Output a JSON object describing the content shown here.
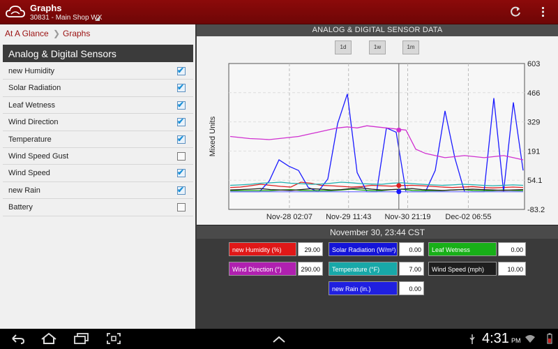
{
  "app": {
    "title": "Graphs",
    "subtitle": "30831 - Main Shop WX"
  },
  "breadcrumb": {
    "home": "At A Glance",
    "separator": "❯",
    "current": "Graphs"
  },
  "sensors": {
    "header": "Analog & Digital Sensors",
    "items": [
      {
        "label": "new Humidity",
        "checked": true
      },
      {
        "label": "Solar Radiation",
        "checked": true
      },
      {
        "label": "Leaf Wetness",
        "checked": true
      },
      {
        "label": "Wind Direction",
        "checked": true
      },
      {
        "label": "Temperature",
        "checked": true
      },
      {
        "label": "Wind Speed Gust",
        "checked": false
      },
      {
        "label": "Wind Speed",
        "checked": true
      },
      {
        "label": "new Rain",
        "checked": true
      },
      {
        "label": "Battery",
        "checked": false
      }
    ]
  },
  "chart": {
    "header": "ANALOG & DIGITAL SENSOR DATA",
    "range_buttons": [
      "1d",
      "1w",
      "1m"
    ],
    "selected_time": "November 30, 23:44 CST"
  },
  "chart_data": {
    "type": "line",
    "ylabel": "Mixed Units",
    "y_ticks": [
      "603",
      "466",
      "329",
      "191",
      "54.1",
      "-83.2"
    ],
    "ylim": [
      -83.2,
      603
    ],
    "x_ticks": [
      "Nov-28 02:07",
      "Nov-29 11:43",
      "Nov-30 21:19",
      "Dec-02 06:55"
    ],
    "cursor_x": 0.575,
    "series": [
      {
        "name": "new Humidity",
        "color": "#e02020",
        "values": [
          20,
          22,
          28,
          35,
          30,
          25,
          22,
          45,
          40,
          30,
          28,
          25,
          22,
          24,
          30,
          28,
          26,
          29,
          30,
          28,
          25,
          22,
          20,
          22,
          24,
          20,
          18,
          20,
          22,
          20
        ]
      },
      {
        "name": "Solar Radiation",
        "color": "#1a1aff",
        "values": [
          0,
          0,
          0,
          0,
          50,
          150,
          120,
          100,
          20,
          0,
          60,
          320,
          460,
          90,
          0,
          0,
          300,
          280,
          0,
          0,
          0,
          100,
          380,
          160,
          0,
          0,
          0,
          440,
          0,
          420,
          100
        ]
      },
      {
        "name": "Wind Direction",
        "color": "#d030d0",
        "values": [
          260,
          255,
          250,
          248,
          245,
          250,
          255,
          260,
          270,
          280,
          290,
          300,
          305,
          300,
          310,
          305,
          300,
          295,
          290,
          200,
          180,
          170,
          160,
          165,
          170,
          165,
          160,
          165,
          170,
          160,
          150
        ]
      },
      {
        "name": "Temperature",
        "color": "#20b0b0",
        "values": [
          30,
          32,
          35,
          40,
          42,
          45,
          40,
          38,
          35,
          36,
          40,
          45,
          42,
          38,
          36,
          35,
          40,
          42,
          38,
          35,
          32,
          30,
          32,
          35,
          33,
          30,
          28,
          30,
          32,
          30
        ]
      },
      {
        "name": "Leaf Wetness",
        "color": "#10a010",
        "values": [
          5,
          5,
          5,
          5,
          5,
          8,
          10,
          6,
          5,
          5,
          5,
          8,
          12,
          8,
          5,
          5,
          10,
          12,
          6,
          5,
          5,
          5,
          8,
          10,
          6,
          5,
          5,
          8,
          6,
          5
        ]
      },
      {
        "name": "Wind Speed",
        "color": "#222222",
        "values": [
          8,
          10,
          12,
          15,
          10,
          8,
          6,
          10,
          14,
          12,
          8,
          10,
          15,
          18,
          12,
          8,
          10,
          12,
          15,
          10,
          8,
          6,
          8,
          10,
          12,
          10,
          8,
          6,
          8,
          10
        ]
      },
      {
        "name": "new Rain",
        "color": "#8080ff",
        "values": [
          0,
          0,
          0,
          0,
          0,
          0,
          0,
          0,
          0,
          0,
          0,
          0,
          0,
          0,
          0,
          0,
          0,
          0,
          0,
          0,
          0,
          0,
          0,
          0,
          0,
          0,
          0,
          0,
          0,
          0
        ]
      }
    ]
  },
  "legend": [
    {
      "name": "new Humidity (%)",
      "value": "29.00",
      "bg": "#e01818",
      "fg": "#ffffff"
    },
    {
      "name": "Solar Radiation (W/m²)",
      "value": "0.00",
      "bg": "#1414d8",
      "fg": "#ffffff"
    },
    {
      "name": "Leaf Wetness",
      "value": "0.00",
      "bg": "#18b018",
      "fg": "#ffffff"
    },
    {
      "name": "Wind Direction (°)",
      "value": "290.00",
      "bg": "#b020b0",
      "fg": "#ffffff"
    },
    {
      "name": "Temperature (°F)",
      "value": "7.00",
      "bg": "#18a8a8",
      "fg": "#ffffff"
    },
    {
      "name": "Wind Speed (mph)",
      "value": "10.00",
      "bg": "#1e1e1e",
      "fg": "#ffffff"
    },
    {
      "name": "new Rain (in.)",
      "value": "0.00",
      "bg": "#2020e0",
      "fg": "#ffffff"
    }
  ],
  "status": {
    "time": "4:31",
    "ampm": "PM"
  },
  "icons": {
    "app": "cloud-icon",
    "refresh": "refresh-icon",
    "menu": "overflow-menu-icon",
    "back": "back-icon",
    "home": "home-icon",
    "recents": "recent-apps-icon",
    "screenshot": "screenshot-icon",
    "up": "chevron-up-icon",
    "usb": "usb-icon",
    "wifi": "wifi-icon",
    "battery": "battery-icon"
  }
}
